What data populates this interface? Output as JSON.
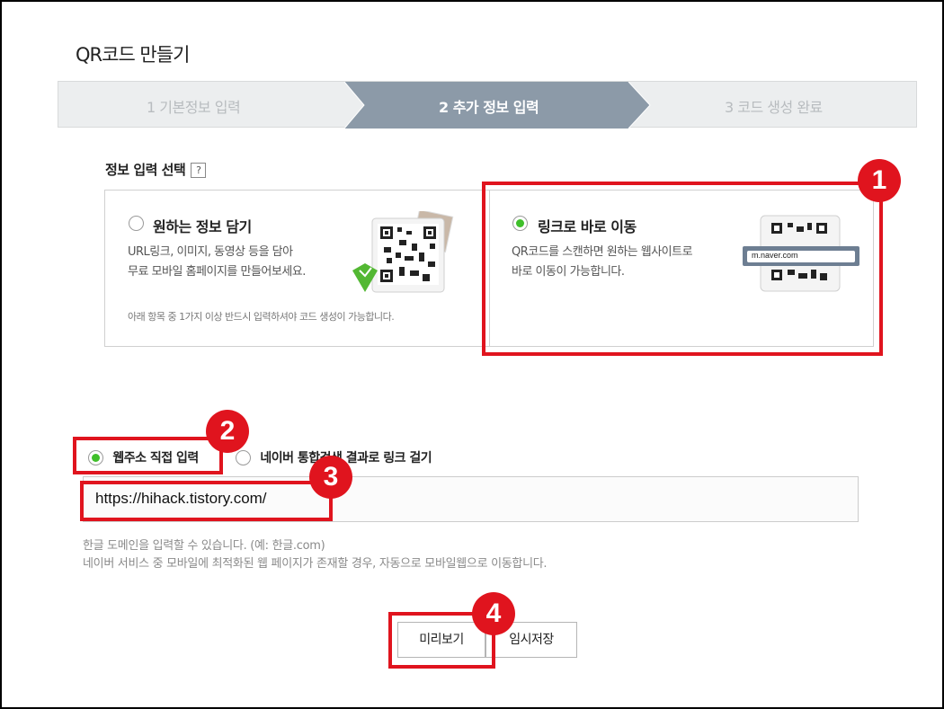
{
  "page": {
    "title": "QR코드 만들기"
  },
  "steps": [
    {
      "label": "1 기본정보 입력",
      "state": "done"
    },
    {
      "label": "2 추가 정보 입력",
      "state": "active"
    },
    {
      "label": "3 코드 생성 완료",
      "state": "pending"
    }
  ],
  "info_select": {
    "label": "정보 입력 선택",
    "help": "?",
    "options": [
      {
        "title": "원하는 정보 담기",
        "desc_line1": "URL링크, 이미지, 동영상 등을 담아",
        "desc_line2": "무료 모바일 홈페이지를 만들어보세요.",
        "note": "아래 항목 중 1가지 이상 반드시 입력하셔야 코드 생성이 가능합니다.",
        "checked": false
      },
      {
        "title": "링크로 바로 이동",
        "desc_line1": "QR코드를 스캔하면 원하는 웹사이트로",
        "desc_line2": "바로 이동이 가능합니다.",
        "url_preview": "m.naver.com",
        "checked": true
      }
    ]
  },
  "link_mode": {
    "direct_label": "웹주소 직접 입력",
    "naver_label": "네이버 통합검색 결과로 링크 걸기",
    "selected": "direct"
  },
  "url_input": {
    "value": "https://hihack.tistory.com/"
  },
  "hints": {
    "line1": "한글 도메인을 입력할 수 있습니다. (예: 한글.com)",
    "line2": "네이버 서비스 중 모바일에 최적화된 웹 페이지가 존재할 경우, 자동으로 모바일웹으로 이동합니다."
  },
  "buttons": {
    "preview": "미리보기",
    "save": "임시저장"
  },
  "badges": {
    "b1": "1",
    "b2": "2",
    "b3": "3",
    "b4": "4"
  },
  "colors": {
    "accent_red": "#e0141e",
    "radio_green": "#3fbf2a",
    "step_active": "#8c9aa8"
  }
}
